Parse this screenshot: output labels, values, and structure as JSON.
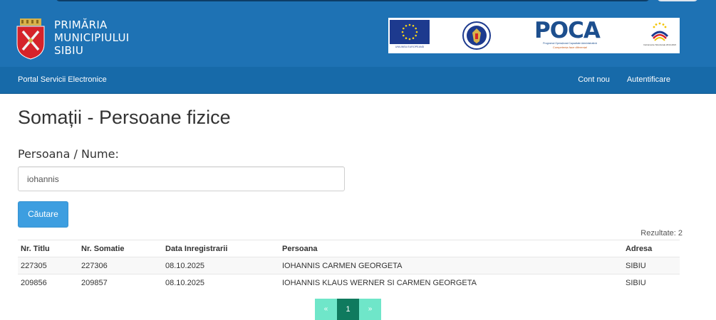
{
  "header": {
    "brand_lines": [
      "PRIMĂRIA",
      "MUNICIPIULUI",
      "SIBIU"
    ],
    "logos": {
      "eu_caption": "UNIUNEA EUROPEANĂ",
      "poca_word": "POCA",
      "poca_sub1": "Programul Operațional Capacitate Administrativă",
      "poca_sub2": "Competența face diferența!",
      "is_caption": "Instrumente Structurale 2014-2020"
    }
  },
  "nav": {
    "brand": "Portal Servicii Electronice",
    "cont_nou": "Cont nou",
    "autentificare": "Autentificare"
  },
  "main": {
    "title": "Somații - Persoane fizice",
    "field_label": "Persoana / Nume:",
    "search_value": "iohannis",
    "search_button": "Căutare",
    "results_count": "Rezultate: 2"
  },
  "table": {
    "headers": [
      "Nr. Titlu",
      "Nr. Somatie",
      "Data Inregistrarii",
      "Persoana",
      "Adresa"
    ],
    "rows": [
      [
        "227305",
        "227306",
        "08.10.2025",
        "IOHANNIS CARMEN GEORGETA",
        "SIBIU"
      ],
      [
        "209856",
        "209857",
        "08.10.2025",
        "IOHANNIS KLAUS WERNER SI CARMEN GEORGETA",
        "SIBIU"
      ]
    ]
  },
  "pagination": {
    "prev": "«",
    "current": "1",
    "next": "»"
  },
  "colors": {
    "header_blue": "#1e72b4",
    "nav_blue": "#176aa9",
    "button_blue": "#3d9ee0",
    "pager_active": "#0f7a5e",
    "pager_light": "#6fe6c9"
  }
}
